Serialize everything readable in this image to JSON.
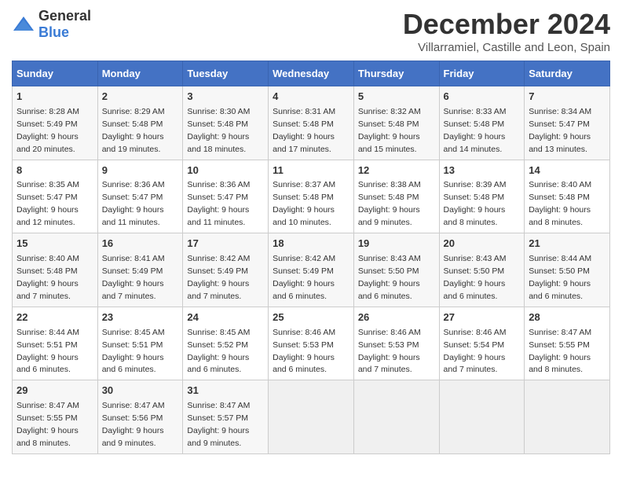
{
  "logo": {
    "general": "General",
    "blue": "Blue"
  },
  "title": "December 2024",
  "subtitle": "Villarramiel, Castille and Leon, Spain",
  "days_header": [
    "Sunday",
    "Monday",
    "Tuesday",
    "Wednesday",
    "Thursday",
    "Friday",
    "Saturday"
  ],
  "weeks": [
    [
      {
        "day": "1",
        "info": "Sunrise: 8:28 AM\nSunset: 5:49 PM\nDaylight: 9 hours\nand 20 minutes."
      },
      {
        "day": "2",
        "info": "Sunrise: 8:29 AM\nSunset: 5:48 PM\nDaylight: 9 hours\nand 19 minutes."
      },
      {
        "day": "3",
        "info": "Sunrise: 8:30 AM\nSunset: 5:48 PM\nDaylight: 9 hours\nand 18 minutes."
      },
      {
        "day": "4",
        "info": "Sunrise: 8:31 AM\nSunset: 5:48 PM\nDaylight: 9 hours\nand 17 minutes."
      },
      {
        "day": "5",
        "info": "Sunrise: 8:32 AM\nSunset: 5:48 PM\nDaylight: 9 hours\nand 15 minutes."
      },
      {
        "day": "6",
        "info": "Sunrise: 8:33 AM\nSunset: 5:48 PM\nDaylight: 9 hours\nand 14 minutes."
      },
      {
        "day": "7",
        "info": "Sunrise: 8:34 AM\nSunset: 5:47 PM\nDaylight: 9 hours\nand 13 minutes."
      }
    ],
    [
      {
        "day": "8",
        "info": "Sunrise: 8:35 AM\nSunset: 5:47 PM\nDaylight: 9 hours\nand 12 minutes."
      },
      {
        "day": "9",
        "info": "Sunrise: 8:36 AM\nSunset: 5:47 PM\nDaylight: 9 hours\nand 11 minutes."
      },
      {
        "day": "10",
        "info": "Sunrise: 8:36 AM\nSunset: 5:47 PM\nDaylight: 9 hours\nand 11 minutes."
      },
      {
        "day": "11",
        "info": "Sunrise: 8:37 AM\nSunset: 5:48 PM\nDaylight: 9 hours\nand 10 minutes."
      },
      {
        "day": "12",
        "info": "Sunrise: 8:38 AM\nSunset: 5:48 PM\nDaylight: 9 hours\nand 9 minutes."
      },
      {
        "day": "13",
        "info": "Sunrise: 8:39 AM\nSunset: 5:48 PM\nDaylight: 9 hours\nand 8 minutes."
      },
      {
        "day": "14",
        "info": "Sunrise: 8:40 AM\nSunset: 5:48 PM\nDaylight: 9 hours\nand 8 minutes."
      }
    ],
    [
      {
        "day": "15",
        "info": "Sunrise: 8:40 AM\nSunset: 5:48 PM\nDaylight: 9 hours\nand 7 minutes."
      },
      {
        "day": "16",
        "info": "Sunrise: 8:41 AM\nSunset: 5:49 PM\nDaylight: 9 hours\nand 7 minutes."
      },
      {
        "day": "17",
        "info": "Sunrise: 8:42 AM\nSunset: 5:49 PM\nDaylight: 9 hours\nand 7 minutes."
      },
      {
        "day": "18",
        "info": "Sunrise: 8:42 AM\nSunset: 5:49 PM\nDaylight: 9 hours\nand 6 minutes."
      },
      {
        "day": "19",
        "info": "Sunrise: 8:43 AM\nSunset: 5:50 PM\nDaylight: 9 hours\nand 6 minutes."
      },
      {
        "day": "20",
        "info": "Sunrise: 8:43 AM\nSunset: 5:50 PM\nDaylight: 9 hours\nand 6 minutes."
      },
      {
        "day": "21",
        "info": "Sunrise: 8:44 AM\nSunset: 5:50 PM\nDaylight: 9 hours\nand 6 minutes."
      }
    ],
    [
      {
        "day": "22",
        "info": "Sunrise: 8:44 AM\nSunset: 5:51 PM\nDaylight: 9 hours\nand 6 minutes."
      },
      {
        "day": "23",
        "info": "Sunrise: 8:45 AM\nSunset: 5:51 PM\nDaylight: 9 hours\nand 6 minutes."
      },
      {
        "day": "24",
        "info": "Sunrise: 8:45 AM\nSunset: 5:52 PM\nDaylight: 9 hours\nand 6 minutes."
      },
      {
        "day": "25",
        "info": "Sunrise: 8:46 AM\nSunset: 5:53 PM\nDaylight: 9 hours\nand 6 minutes."
      },
      {
        "day": "26",
        "info": "Sunrise: 8:46 AM\nSunset: 5:53 PM\nDaylight: 9 hours\nand 7 minutes."
      },
      {
        "day": "27",
        "info": "Sunrise: 8:46 AM\nSunset: 5:54 PM\nDaylight: 9 hours\nand 7 minutes."
      },
      {
        "day": "28",
        "info": "Sunrise: 8:47 AM\nSunset: 5:55 PM\nDaylight: 9 hours\nand 8 minutes."
      }
    ],
    [
      {
        "day": "29",
        "info": "Sunrise: 8:47 AM\nSunset: 5:55 PM\nDaylight: 9 hours\nand 8 minutes."
      },
      {
        "day": "30",
        "info": "Sunrise: 8:47 AM\nSunset: 5:56 PM\nDaylight: 9 hours\nand 9 minutes."
      },
      {
        "day": "31",
        "info": "Sunrise: 8:47 AM\nSunset: 5:57 PM\nDaylight: 9 hours\nand 9 minutes."
      },
      {
        "day": "",
        "info": ""
      },
      {
        "day": "",
        "info": ""
      },
      {
        "day": "",
        "info": ""
      },
      {
        "day": "",
        "info": ""
      }
    ]
  ]
}
